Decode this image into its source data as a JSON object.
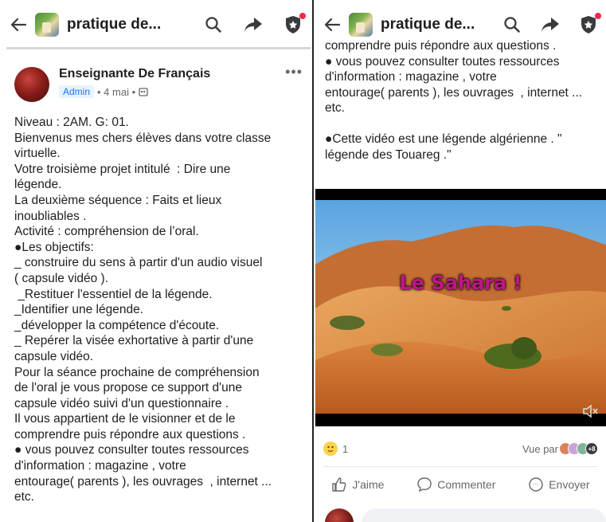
{
  "header": {
    "title": "pratique de...",
    "accent_color": "#1c1e21",
    "notification_color": "#f02849",
    "icons": [
      "back-arrow-icon",
      "search-icon",
      "share-icon",
      "shield-icon"
    ]
  },
  "post": {
    "author": "Enseignante De Français",
    "role_badge": "Admin",
    "meta": "• 4 mai •",
    "more": "•••",
    "lines": [
      "Niveau : 2AM. G: 01.",
      "Bienvenus mes chers élèves dans votre classe",
      "virtuelle.",
      "Votre troisième projet intitulé  : Dire une",
      "légende.",
      "La deuxième séquence : Faits et lieux",
      "inoubliables .",
      "Activité : compréhension de l’oral.",
      "●Les objectifs:",
      "_ construire du sens à partir d'un audio visuel",
      "( capsule vidéo ).",
      " _Restituer l'essentiel de la légende.",
      "_Identifier une légende.",
      "_développer la compétence d'écoute.",
      "_ Repérer la visée exhortative à partir d'une",
      "capsule vidéo.",
      "Pour la séance prochaine de compréhension",
      "de l'oral je vous propose ce support d'une",
      "capsule vidéo suivi d'un questionnaire .",
      "Il vous appartient de le visionner et de le",
      "comprendre puis répondre aux questions .",
      "● vous pouvez consulter toutes ressources",
      "d'information : magazine , votre",
      "entourage( parents ), les ouvrages  , internet ...",
      "etc."
    ],
    "continued_lines": [
      "comprendre puis répondre aux questions .",
      "● vous pouvez consulter toutes ressources",
      "d'information : magazine , votre",
      "entourage( parents ), les ouvrages  , internet ...",
      "etc."
    ],
    "video_intro_lines": [
      "●Cette vidéo est une légende algérienne . \"",
      "légende des Touareg .\""
    ],
    "video": {
      "caption": "Le Sahara !",
      "caption_color": "#c0148c"
    },
    "reaction_count": "1",
    "seen_by_label": "Vue par",
    "seen_by_extra": "+8",
    "actions": {
      "like": "J'aime",
      "comment": "Commenter",
      "send": "Envoyer"
    }
  }
}
